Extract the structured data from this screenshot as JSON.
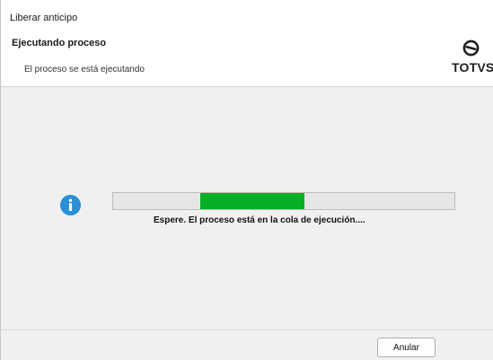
{
  "window": {
    "title": "Liberar anticipo"
  },
  "header": {
    "title": "Ejecutando proceso",
    "subtitle": "El proceso se está ejecutando",
    "logo_text": "TOTVS",
    "logo_icon": "totvs-logo-icon"
  },
  "content": {
    "icon": "info-icon",
    "progress": {
      "fill_start_fraction": 0.255,
      "fill_end_fraction": 0.56,
      "color": "#06b025"
    },
    "status_text": "Espere. El proceso está en la cola de ejecución...."
  },
  "footer": {
    "cancel_label": "Anular"
  },
  "colors": {
    "info_icon": "#2b8fd6",
    "progress_fill": "#06b025",
    "background": "#f0f0f0"
  }
}
